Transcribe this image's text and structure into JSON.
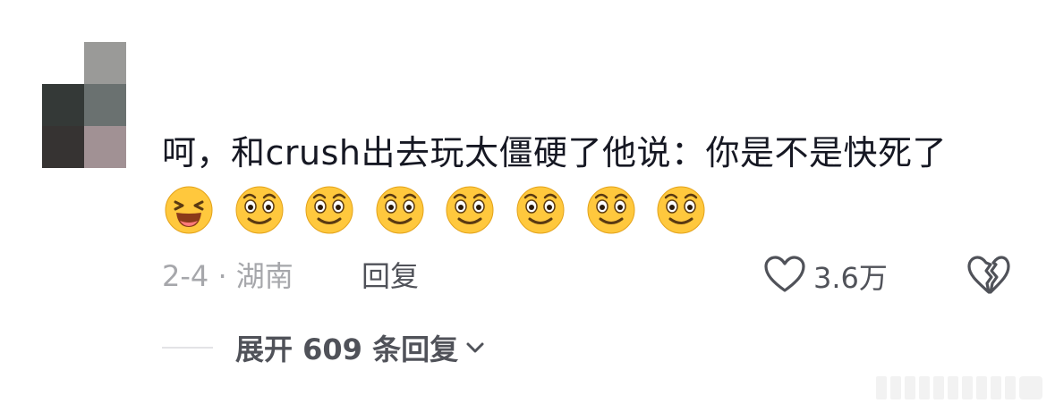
{
  "comment": {
    "avatar_icon": "pixelated-avatar",
    "text": "呵，和crush出去玩太僵硬了他说：你是不是快死了",
    "emojis": [
      "laughing-emoji",
      "smile-emoji",
      "smile-emoji",
      "smile-emoji",
      "smile-emoji",
      "smile-emoji",
      "smile-emoji",
      "smile-emoji"
    ],
    "meta": "2-4 · 湖南",
    "reply_label": "回复",
    "like_count": "3.6万",
    "like_icon": "heart-outline-icon",
    "dislike_icon": "broken-heart-icon"
  },
  "replies": {
    "expand_label": "展开 609 条回复",
    "chevron_icon": "chevron-down-icon"
  },
  "colors": {
    "text_primary": "#161823",
    "text_secondary": "#505259",
    "text_meta": "#a6a7ab",
    "emoji_yellow": "#ffc83d"
  }
}
